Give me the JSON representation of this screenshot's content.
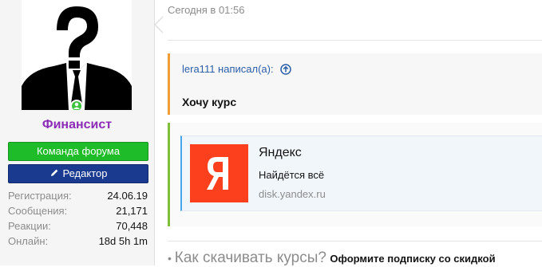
{
  "user": {
    "name": "Финансист",
    "banner_team": "Команда форума",
    "banner_editor": "Редактор",
    "stats": [
      {
        "label": "Регистрация:",
        "value": "24.06.19"
      },
      {
        "label": "Сообщения:",
        "value": "21,171"
      },
      {
        "label": "Реакции:",
        "value": "70,448"
      },
      {
        "label": "Онлайн:",
        "value": "18d 5h 1m"
      }
    ]
  },
  "post": {
    "date": "Сегодня в 01:56",
    "quote_author": "lera111 написал(а):",
    "quote_text": "Хочу курс",
    "embed": {
      "title": "Яндекс",
      "description": "Найдётся всё",
      "url": "disk.yandex.ru",
      "logo_letter": "Я"
    },
    "bottom_question": "Как скачивать курсы?",
    "bottom_subscribe": "Оформите подписку со скидкой"
  },
  "colors": {
    "username": "#8a2cb5",
    "team_banner": "#1fbc2a",
    "editor_banner": "#1a3a8f",
    "quote_border": "#f29d38",
    "embed_border": "#7fbf3c",
    "link": "#2c5ea8",
    "yandex": "#fc3f1d",
    "online_dot": "#3ec43e"
  }
}
